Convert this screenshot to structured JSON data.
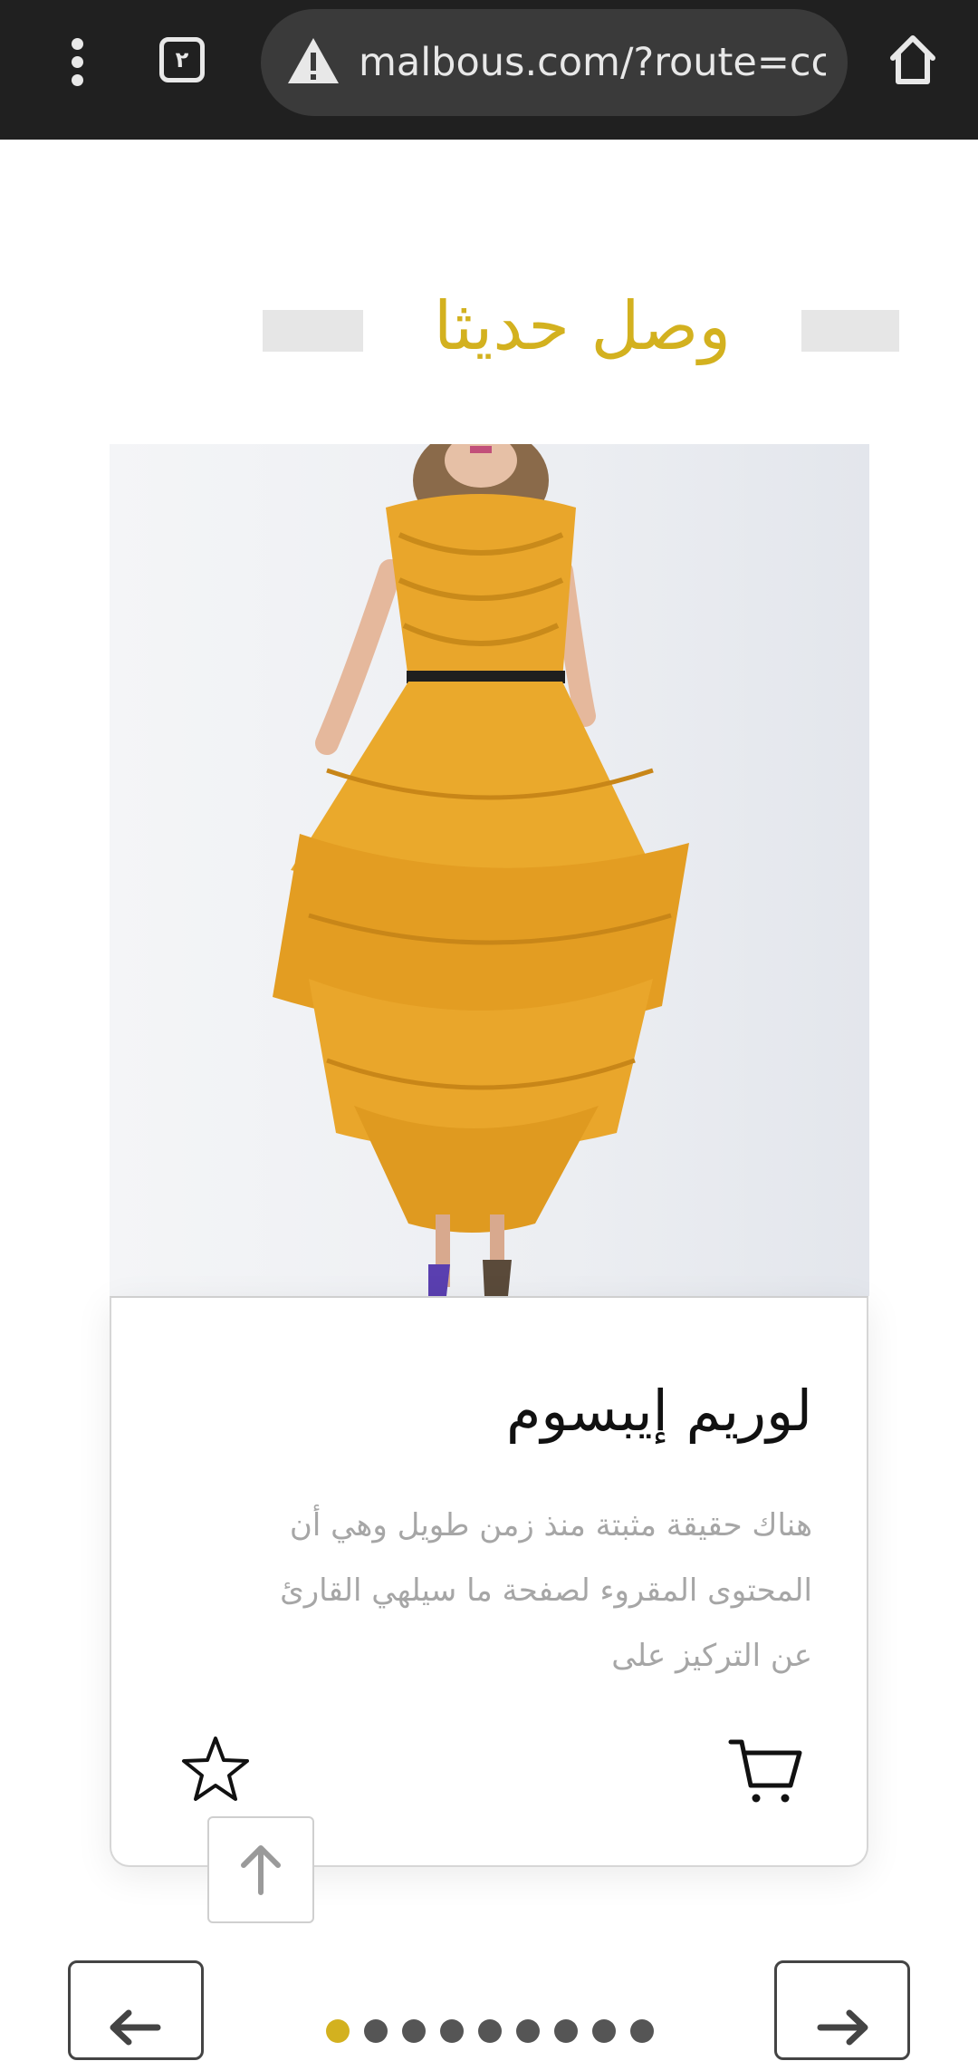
{
  "browser": {
    "tab_count": "٢",
    "url": "malbous.com/?route=cc",
    "icons": [
      "more-vert-icon",
      "tabs-icon",
      "warning-icon",
      "home-icon"
    ]
  },
  "section": {
    "title": "وصل حديثا"
  },
  "product": {
    "image_alt": "yellow ruffled dress",
    "title": "لوريم إيبسوم",
    "description_lines": [
      "هناك حقيقة مثبتة منذ زمن طويل وهي أن",
      "المحتوى المقروء لصفحة ما سيلهي القارئ",
      "عن التركيز على"
    ]
  },
  "carousel": {
    "dot_count": 9,
    "active_dot": 0
  },
  "colors": {
    "accent": "#d3b11f",
    "chrome_bg": "#202020",
    "url_pill": "#3a3a3a",
    "dress": "#e9a62b"
  }
}
